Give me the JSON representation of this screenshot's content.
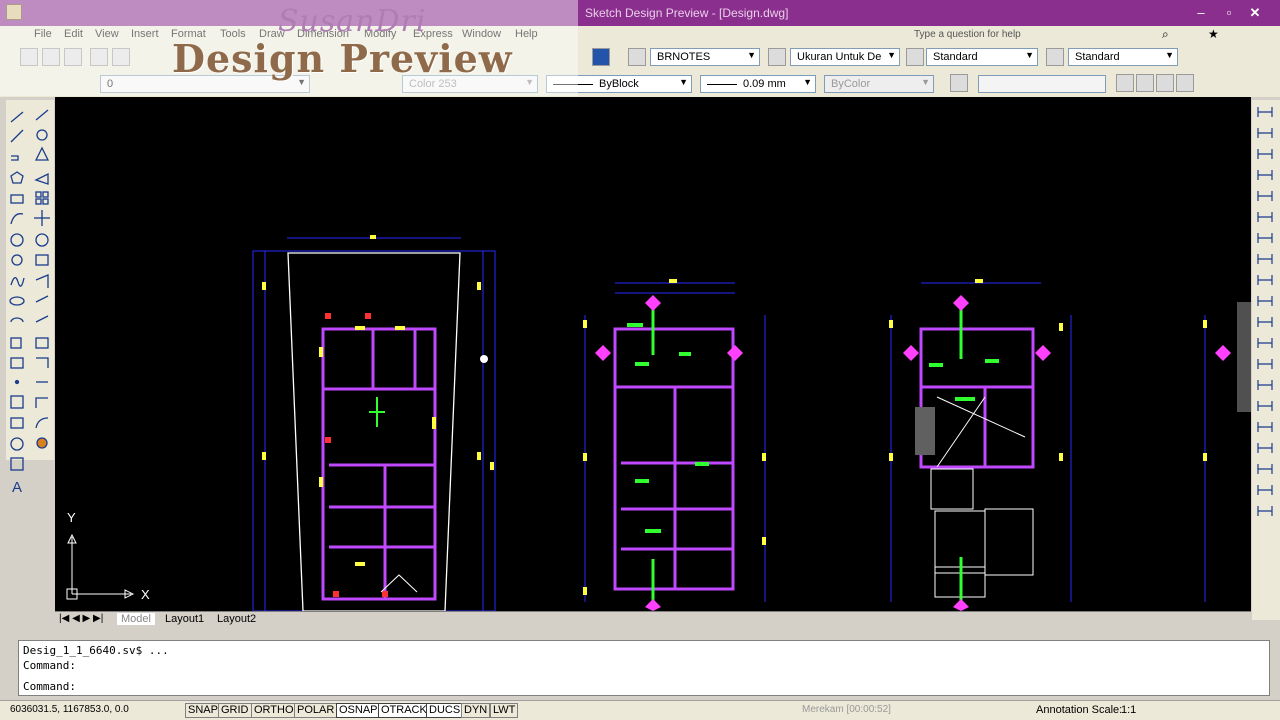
{
  "titlebar": {
    "title": "Sketch Design Preview - [Design.dwg]",
    "minimize": "–",
    "restore": "▫",
    "close": "✕"
  },
  "menu": {
    "items": [
      "File",
      "Edit",
      "View",
      "Insert",
      "Format",
      "Tools",
      "Draw",
      "Dimension",
      "Modify",
      "Express",
      "Window",
      "Help"
    ],
    "help_placeholder": "Type a question for help"
  },
  "watermark": {
    "line1": "SusanDri",
    "line2": "Design Preview"
  },
  "toolbar": {
    "text_style": "BRNOTES",
    "dim_style": "Ukuran Untuk De",
    "table_style": "Standard",
    "multileader_style": "Standard",
    "layer": "0",
    "color": "Color 253",
    "linetype": "ByBlock",
    "lineweight": "0.09 mm",
    "plotstyle": "ByColor"
  },
  "ucs": {
    "x_label": "X",
    "y_label": "Y"
  },
  "tabs": [
    "Model",
    "Layout1",
    "Layout2"
  ],
  "command": {
    "line1": "Desig_1_1_6640.sv$ ...",
    "line2": "Command:",
    "line3": "Command:"
  },
  "status": {
    "coords": "6036031.5, 1167853.0, 0.0",
    "buttons": [
      "SNAP",
      "GRID",
      "ORTHO",
      "POLAR",
      "OSNAP",
      "OTRACK",
      "DUCS",
      "DYN",
      "LWT"
    ],
    "recording": "Merekam [00:00:52]",
    "annotation_scale_label": "Annotation Scale:",
    "annotation_scale_value": "1:1"
  }
}
